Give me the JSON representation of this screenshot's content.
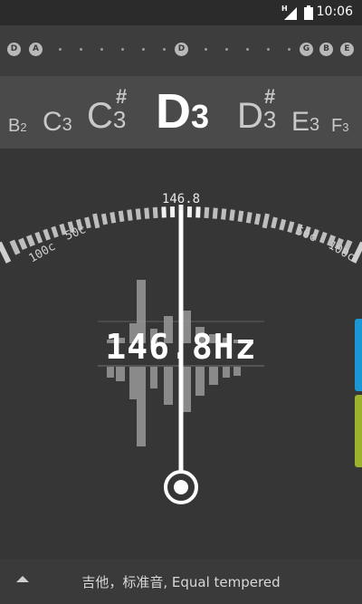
{
  "status": {
    "network_letter": "H",
    "time": "10:06"
  },
  "strings": [
    "D",
    "A",
    "D",
    "G",
    "B",
    "E"
  ],
  "notes": [
    {
      "letter": "B",
      "sharp": "",
      "octave": "2"
    },
    {
      "letter": "C",
      "sharp": "",
      "octave": "3"
    },
    {
      "letter": "C",
      "sharp": "#",
      "octave": "3"
    },
    {
      "letter": "D",
      "sharp": "",
      "octave": "3"
    },
    {
      "letter": "D",
      "sharp": "#",
      "octave": "3"
    },
    {
      "letter": "E",
      "sharp": "",
      "octave": "3"
    },
    {
      "letter": "F",
      "sharp": "",
      "octave": "3"
    }
  ],
  "scale_labels": {
    "left_100": "100c",
    "left_50": "50c",
    "right_50": "50c",
    "right_100": "100c"
  },
  "frequency_top": "146.8",
  "frequency_main": "146.8Hz",
  "cents_offset": 0,
  "footer": {
    "label": "吉他，标准音, Equal tempered"
  },
  "colors": {
    "accent_blue": "#1a98d6",
    "accent_green": "#9cb22c",
    "background": "#363636"
  }
}
